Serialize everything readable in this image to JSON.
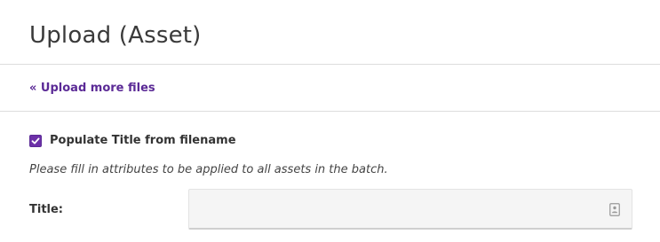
{
  "header": {
    "title": "Upload (Asset)"
  },
  "nav": {
    "back_link_label": "« Upload more files"
  },
  "form": {
    "populate_title_checkbox": {
      "label": "Populate Title from filename",
      "checked": true
    },
    "help_text": "Please fill in attributes to be applied to all assets in the batch.",
    "title_field": {
      "label": "Title:",
      "value": "",
      "placeholder": "",
      "icon": "contact-card-icon"
    }
  },
  "colors": {
    "accent": "#5b2a96",
    "checkbox_fill": "#6d31a8",
    "input_background": "#f5f5f5",
    "divider": "#dddddd"
  }
}
